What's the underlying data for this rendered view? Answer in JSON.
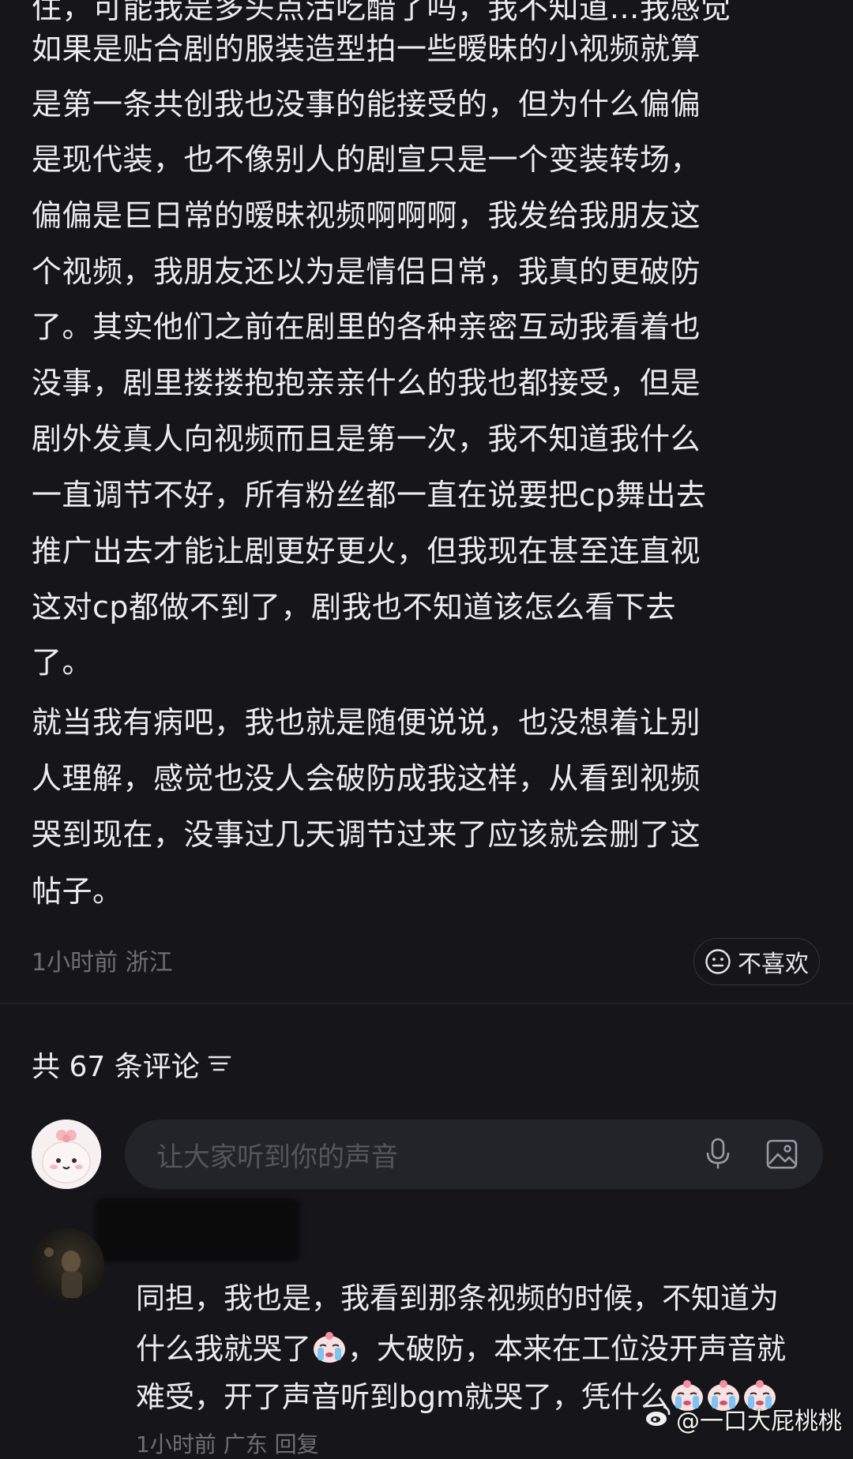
{
  "post": {
    "lines": [
      "住，可能我是多头点活吃醋了吗，我不知道…我感觉",
      "如果是贴合剧的服装造型拍一些暧昧的小视频就算",
      "是第一条共创我也没事的能接受的，但为什么偏偏",
      "是现代装，也不像别人的剧宣只是一个变装转场，",
      "偏偏是巨日常的暧昧视频啊啊啊，我发给我朋友这",
      "个视频，我朋友还以为是情侣日常，我真的更破防",
      "了。其实他们之前在剧里的各种亲密互动我看着也",
      "没事，剧里搂搂抱抱亲亲什么的我也都接受，但是",
      "剧外发真人向视频而且是第一次，我不知道我什么",
      "一直调节不好，所有粉丝都一直在说要把cp舞出去",
      "推广出去才能让剧更好更火，但我现在甚至连直视",
      "这对cp都做不到了，剧我也不知道该怎么看下去",
      "了。",
      "就当我有病吧，我也就是随便说说，也没想着让别",
      "人理解，感觉也没人会破防成我这样，从看到视频",
      "哭到现在，没事过几天调节过来了应该就会删了这",
      "帖子。"
    ],
    "meta": "1小时前 浙江",
    "dislike_label": "不喜欢"
  },
  "comments": {
    "count_label": "共 67 条评论",
    "input_placeholder": "让大家听到你的声音",
    "first": {
      "line1": "同担，我也是，我看到那条视频的时候，不知道为",
      "line2a": "什么我就哭了",
      "line2b": "，大破防，本来在工位没开声音就",
      "line3": "难受，开了声音听到bgm就哭了，凭什么",
      "meta": "1小时前 广东  回复"
    }
  },
  "watermark": "@一口大屁桃桃",
  "icons": [
    "neutral-face-icon",
    "sort-icon",
    "microphone-icon",
    "image-icon",
    "crying-emoji",
    "weibo-icon"
  ]
}
